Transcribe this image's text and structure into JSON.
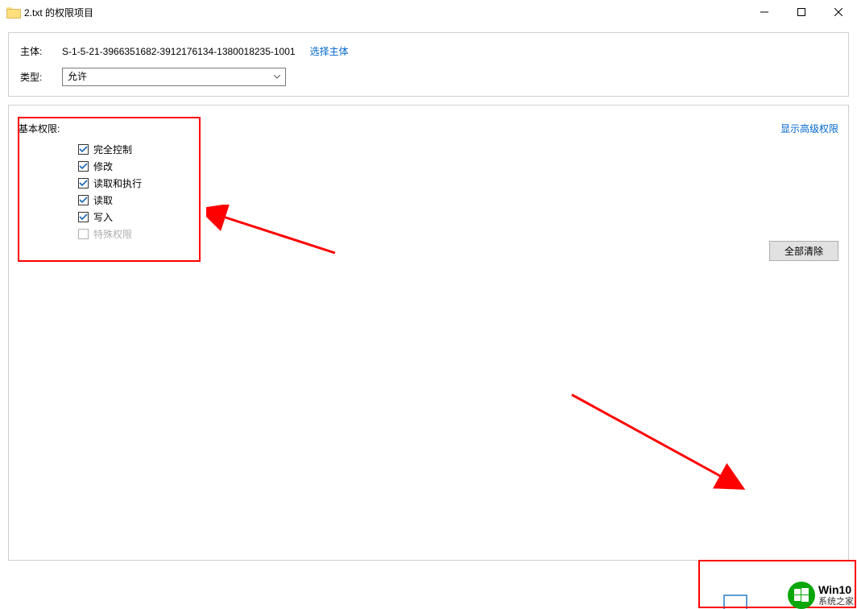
{
  "window": {
    "title": "2.txt 的权限项目"
  },
  "header": {
    "subject_label": "主体:",
    "subject_value": "S-1-5-21-3966351682-3912176134-1380018235-1001",
    "select_subject_link": "选择主体",
    "type_label": "类型:",
    "type_selected": "允许"
  },
  "permissions": {
    "title": "基本权限:",
    "advanced_link": "显示高级权限",
    "items": [
      {
        "label": "完全控制",
        "checked": true,
        "enabled": true
      },
      {
        "label": "修改",
        "checked": true,
        "enabled": true
      },
      {
        "label": "读取和执行",
        "checked": true,
        "enabled": true
      },
      {
        "label": "读取",
        "checked": true,
        "enabled": true
      },
      {
        "label": "写入",
        "checked": true,
        "enabled": true
      },
      {
        "label": "特殊权限",
        "checked": false,
        "enabled": false
      }
    ],
    "clear_all": "全部清除"
  },
  "watermark": {
    "line1": "Win10",
    "line2": "系统之家"
  }
}
